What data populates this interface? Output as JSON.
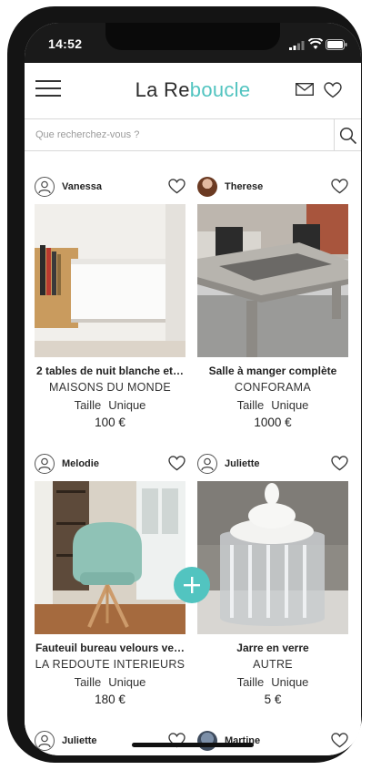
{
  "status": {
    "time": "14:52"
  },
  "header": {
    "brand_part1": "La Re",
    "brand_part2": "boucle",
    "accent_color": "#52c4c0"
  },
  "search": {
    "placeholder": "Que recherchez-vous ?"
  },
  "listings": [
    {
      "seller": "Vanessa",
      "title": "2 tables de nuit blanche et…",
      "brand": "MAISONS DU MONDE",
      "size_label": "Taille",
      "size_value": "Unique",
      "price": "100 €"
    },
    {
      "seller": "Therese",
      "title": "Salle à manger complète",
      "brand": "CONFORAMA",
      "size_label": "Taille",
      "size_value": "Unique",
      "price": "1000 €"
    },
    {
      "seller": "Melodie",
      "title": "Fauteuil bureau velours ve…",
      "brand": "LA REDOUTE INTERIEURS",
      "size_label": "Taille",
      "size_value": "Unique",
      "price": "180 €"
    },
    {
      "seller": "Juliette",
      "title": "Jarre en verre",
      "brand": "AUTRE",
      "size_label": "Taille",
      "size_value": "Unique",
      "price": "5 €"
    },
    {
      "seller": "Juliette"
    },
    {
      "seller": "Martine"
    }
  ]
}
